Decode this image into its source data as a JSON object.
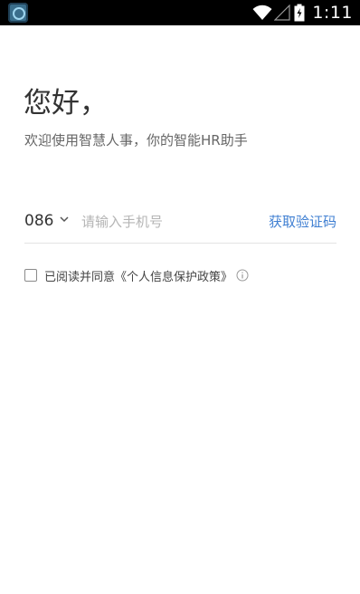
{
  "status_bar": {
    "time": "1:11",
    "icons": [
      "app-icon",
      "wifi-icon",
      "signal-icon",
      "battery-charging-icon"
    ]
  },
  "login": {
    "greeting": "您好，",
    "subtitle": "欢迎使用智慧人事，你的智能HR助手",
    "country_code": "086",
    "phone_placeholder": "请输入手机号",
    "get_code_label": "获取验证码",
    "agree_prefix": "已阅读并同意",
    "policy_link": "《个人信息保护政策》"
  },
  "colors": {
    "accent": "#3f7fd2",
    "text_primary": "#333333",
    "text_secondary": "#666666",
    "placeholder": "#b5b5b5",
    "divider": "#e4e4e4"
  }
}
